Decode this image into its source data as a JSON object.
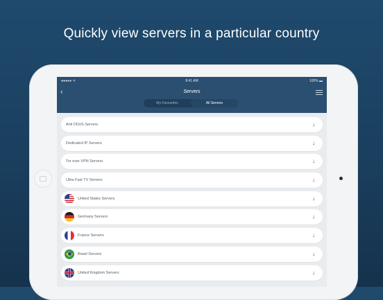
{
  "headline": "Quickly view servers in a particular country",
  "status_bar": {
    "signal": "●●●●● ᯤ",
    "time": "8:41 AM",
    "battery": "100% ▬"
  },
  "nav": {
    "back_icon": "‹",
    "title": "Servers",
    "segments": [
      {
        "label": "My Favourites",
        "active": false
      },
      {
        "label": "All Servers",
        "active": true
      }
    ]
  },
  "server_rows": [
    {
      "label": "Anti DDoS Servers",
      "flag": null
    },
    {
      "label": "Dedicated IP Servers",
      "flag": null
    },
    {
      "label": "Tor over VPN Servers",
      "flag": null
    },
    {
      "label": "Ultra Fast TV Servers",
      "flag": null
    },
    {
      "label": "United States Servers",
      "flag": "us"
    },
    {
      "label": "Germany Servers",
      "flag": "de"
    },
    {
      "label": "France Servers",
      "flag": "fr"
    },
    {
      "label": "Brasil Servers",
      "flag": "br"
    },
    {
      "label": "United Kingdom Servers",
      "flag": "uk"
    }
  ],
  "row_arrow_icon": "↓",
  "colors": {
    "nav_bg": "#2b4f70",
    "page_bg": "#1f4a6d",
    "list_bg": "#e9ecef"
  }
}
